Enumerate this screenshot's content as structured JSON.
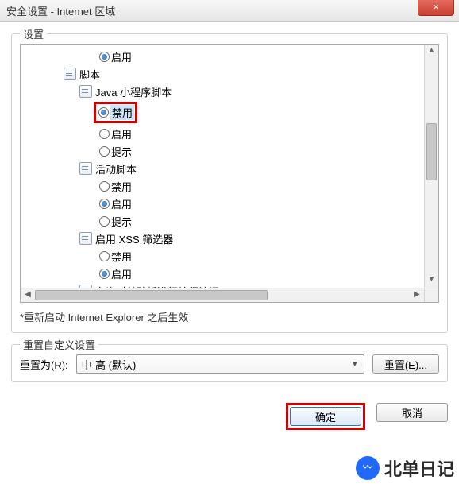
{
  "window": {
    "title": "安全设置 - Internet 区域",
    "close_label": "×"
  },
  "settings_group": {
    "title": "设置",
    "note": "*重新启动 Internet Explorer 之后生效",
    "tree": [
      {
        "type": "radio",
        "indent": 3,
        "label": "启用",
        "checked": true
      },
      {
        "type": "category",
        "indent": 1,
        "label": "脚本",
        "icon": "script-icon"
      },
      {
        "type": "category",
        "indent": 2,
        "label": "Java 小程序脚本",
        "icon": "script-icon"
      },
      {
        "type": "radio",
        "indent": 3,
        "label": "禁用",
        "checked": true,
        "highlighted": true
      },
      {
        "type": "radio",
        "indent": 3,
        "label": "启用",
        "checked": false
      },
      {
        "type": "radio",
        "indent": 3,
        "label": "提示",
        "checked": false
      },
      {
        "type": "category",
        "indent": 2,
        "label": "活动脚本",
        "icon": "script-icon"
      },
      {
        "type": "radio",
        "indent": 3,
        "label": "禁用",
        "checked": false
      },
      {
        "type": "radio",
        "indent": 3,
        "label": "启用",
        "checked": true
      },
      {
        "type": "radio",
        "indent": 3,
        "label": "提示",
        "checked": false
      },
      {
        "type": "category",
        "indent": 2,
        "label": "启用 XSS 筛选器",
        "icon": "script-icon"
      },
      {
        "type": "radio",
        "indent": 3,
        "label": "禁用",
        "checked": false
      },
      {
        "type": "radio",
        "indent": 3,
        "label": "启用",
        "checked": true
      },
      {
        "type": "category",
        "indent": 2,
        "label": "允许对剪贴板进行编程访问",
        "icon": "script-icon"
      }
    ]
  },
  "reset_group": {
    "title": "重置自定义设置",
    "to_label": "重置为(R):",
    "level_selected": "中-高 (默认)",
    "reset_button": "重置(E)..."
  },
  "actions": {
    "ok": "确定",
    "cancel": "取消"
  },
  "watermark": {
    "badge": "‌‌ω",
    "text": "北单日记"
  }
}
